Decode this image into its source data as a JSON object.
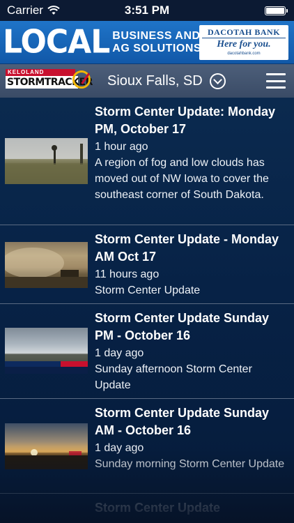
{
  "status_bar": {
    "carrier": "Carrier",
    "time": "3:51 PM",
    "battery_level": 1.0
  },
  "ad": {
    "headline": "LOCAL",
    "subline_1": "BUSINESS AND",
    "subline_2": "AG SOLUTIONS",
    "bank_name": "DACOTAH BANK",
    "bank_tagline": "Here for you.",
    "bank_url": "dacotahbank.com"
  },
  "nav": {
    "logo_top": "KELOLAND",
    "logo_main": "STORMTRACKER",
    "location": "Sioux Falls, SD",
    "chevron_icon": "chevron-down-circle-icon",
    "menu_icon": "hamburger-menu-icon"
  },
  "items": [
    {
      "title": "Storm Center Update: Monday PM, October 17",
      "time": "1 hour ago",
      "description": "A region of fog and low clouds has moved out of NW Iowa to cover the southeast corner of South Dakota."
    },
    {
      "title": "Storm Center Update - Monday AM Oct 17",
      "time": "11 hours ago",
      "description": "Storm Center Update"
    },
    {
      "title": "Storm Center Update Sunday PM - October 16",
      "time": "1 day ago",
      "description": "Sunday afternoon Storm Center Update"
    },
    {
      "title": "Storm Center Update Sunday AM - October 16",
      "time": "1 day ago",
      "description": "Sunday morning Storm Center Update"
    },
    {
      "title": "Storm Center Update"
    }
  ],
  "colors": {
    "accent_yellow": "#f2b705",
    "brand_red": "#c8102e",
    "ad_blue": "#1f74c8",
    "nav_bar": "#46576f",
    "list_background": "#072246"
  }
}
